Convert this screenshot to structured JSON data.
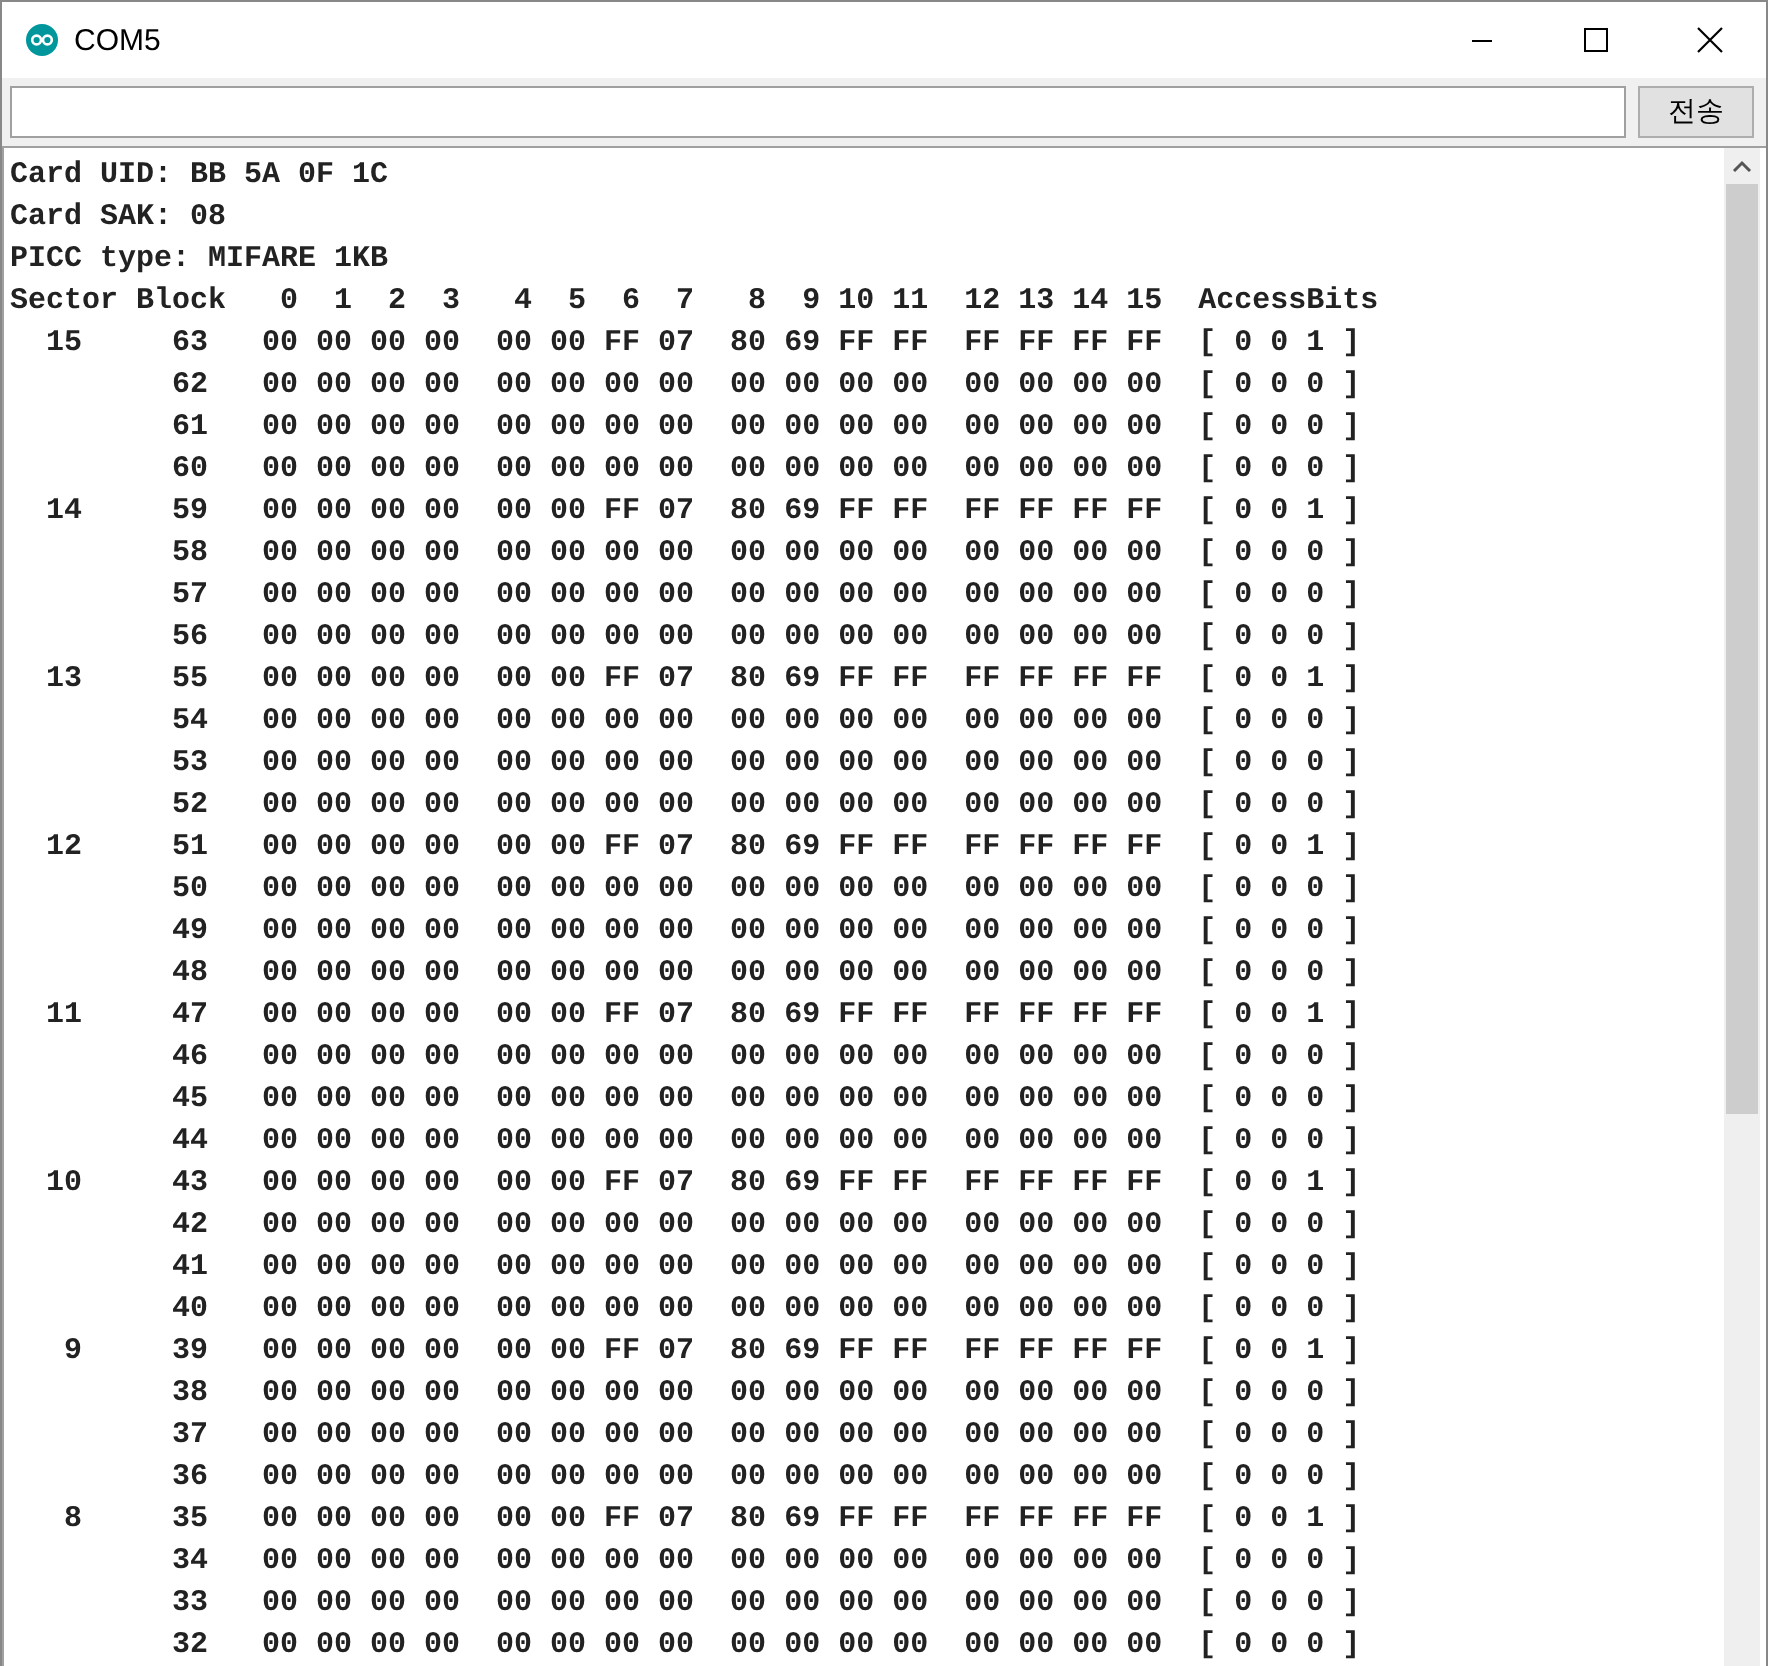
{
  "window": {
    "title": "COM5"
  },
  "send_button": "전송",
  "output_lines": [
    "Card UID: BB 5A 0F 1C",
    "Card SAK: 08",
    "PICC type: MIFARE 1KB",
    "Sector Block   0  1  2  3   4  5  6  7   8  9 10 11  12 13 14 15  AccessBits",
    "  15     63   00 00 00 00  00 00 FF 07  80 69 FF FF  FF FF FF FF  [ 0 0 1 ]",
    "         62   00 00 00 00  00 00 00 00  00 00 00 00  00 00 00 00  [ 0 0 0 ]",
    "         61   00 00 00 00  00 00 00 00  00 00 00 00  00 00 00 00  [ 0 0 0 ]",
    "         60   00 00 00 00  00 00 00 00  00 00 00 00  00 00 00 00  [ 0 0 0 ]",
    "  14     59   00 00 00 00  00 00 FF 07  80 69 FF FF  FF FF FF FF  [ 0 0 1 ]",
    "         58   00 00 00 00  00 00 00 00  00 00 00 00  00 00 00 00  [ 0 0 0 ]",
    "         57   00 00 00 00  00 00 00 00  00 00 00 00  00 00 00 00  [ 0 0 0 ]",
    "         56   00 00 00 00  00 00 00 00  00 00 00 00  00 00 00 00  [ 0 0 0 ]",
    "  13     55   00 00 00 00  00 00 FF 07  80 69 FF FF  FF FF FF FF  [ 0 0 1 ]",
    "         54   00 00 00 00  00 00 00 00  00 00 00 00  00 00 00 00  [ 0 0 0 ]",
    "         53   00 00 00 00  00 00 00 00  00 00 00 00  00 00 00 00  [ 0 0 0 ]",
    "         52   00 00 00 00  00 00 00 00  00 00 00 00  00 00 00 00  [ 0 0 0 ]",
    "  12     51   00 00 00 00  00 00 FF 07  80 69 FF FF  FF FF FF FF  [ 0 0 1 ]",
    "         50   00 00 00 00  00 00 00 00  00 00 00 00  00 00 00 00  [ 0 0 0 ]",
    "         49   00 00 00 00  00 00 00 00  00 00 00 00  00 00 00 00  [ 0 0 0 ]",
    "         48   00 00 00 00  00 00 00 00  00 00 00 00  00 00 00 00  [ 0 0 0 ]",
    "  11     47   00 00 00 00  00 00 FF 07  80 69 FF FF  FF FF FF FF  [ 0 0 1 ]",
    "         46   00 00 00 00  00 00 00 00  00 00 00 00  00 00 00 00  [ 0 0 0 ]",
    "         45   00 00 00 00  00 00 00 00  00 00 00 00  00 00 00 00  [ 0 0 0 ]",
    "         44   00 00 00 00  00 00 00 00  00 00 00 00  00 00 00 00  [ 0 0 0 ]",
    "  10     43   00 00 00 00  00 00 FF 07  80 69 FF FF  FF FF FF FF  [ 0 0 1 ]",
    "         42   00 00 00 00  00 00 00 00  00 00 00 00  00 00 00 00  [ 0 0 0 ]",
    "         41   00 00 00 00  00 00 00 00  00 00 00 00  00 00 00 00  [ 0 0 0 ]",
    "         40   00 00 00 00  00 00 00 00  00 00 00 00  00 00 00 00  [ 0 0 0 ]",
    "   9     39   00 00 00 00  00 00 FF 07  80 69 FF FF  FF FF FF FF  [ 0 0 1 ]",
    "         38   00 00 00 00  00 00 00 00  00 00 00 00  00 00 00 00  [ 0 0 0 ]",
    "         37   00 00 00 00  00 00 00 00  00 00 00 00  00 00 00 00  [ 0 0 0 ]",
    "         36   00 00 00 00  00 00 00 00  00 00 00 00  00 00 00 00  [ 0 0 0 ]",
    "   8     35   00 00 00 00  00 00 FF 07  80 69 FF FF  FF FF FF FF  [ 0 0 1 ]",
    "         34   00 00 00 00  00 00 00 00  00 00 00 00  00 00 00 00  [ 0 0 0 ]",
    "         33   00 00 00 00  00 00 00 00  00 00 00 00  00 00 00 00  [ 0 0 0 ]",
    "         32   00 00 00 00  00 00 00 00  00 00 00 00  00 00 00 00  [ 0 0 0 ]"
  ]
}
